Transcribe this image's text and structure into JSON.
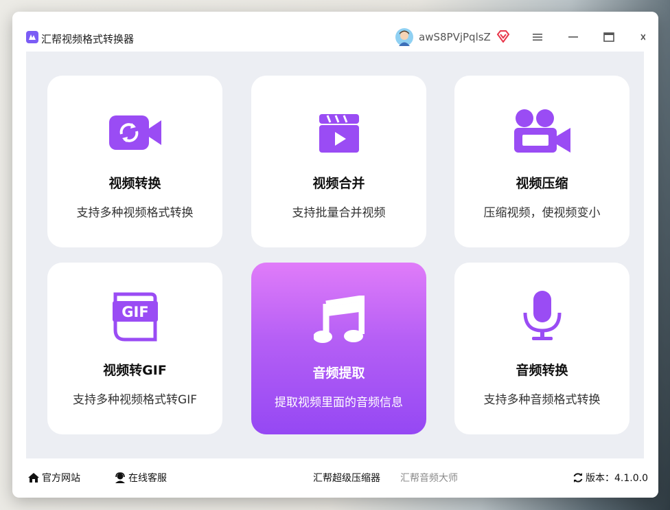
{
  "window": {
    "title": "汇帮视频格式转换器",
    "username": "awS8PVjPqlsZ"
  },
  "cards": [
    {
      "title": "视频转换",
      "desc": "支持多种视频格式转换",
      "icon": "video-convert-icon"
    },
    {
      "title": "视频合并",
      "desc": "支持批量合并视频",
      "icon": "clapperboard-play-icon"
    },
    {
      "title": "视频压缩",
      "desc": "压缩视频，使视频变小",
      "icon": "movie-camera-icon"
    },
    {
      "title": "视频转GIF",
      "desc": "支持多种视频格式转GIF",
      "icon": "gif-file-icon",
      "icon_text": "GIF"
    },
    {
      "title": "音频提取",
      "desc": "提取视频里面的音频信息",
      "icon": "music-note-icon",
      "active": true
    },
    {
      "title": "音频转换",
      "desc": "支持多种音频格式转换",
      "icon": "microphone-icon"
    }
  ],
  "footer": {
    "home": "官方网站",
    "service": "在线客服",
    "compress": "汇帮超级压缩器",
    "audio": "汇帮音频大师",
    "version": "版本：4.1.0.0"
  },
  "colors": {
    "accent": "#9a4cf4",
    "active_gradient_top": "#e07cf9",
    "active_gradient_bottom": "#9548f3",
    "vip": "#e8364a",
    "content_bg": "#eceef3"
  }
}
